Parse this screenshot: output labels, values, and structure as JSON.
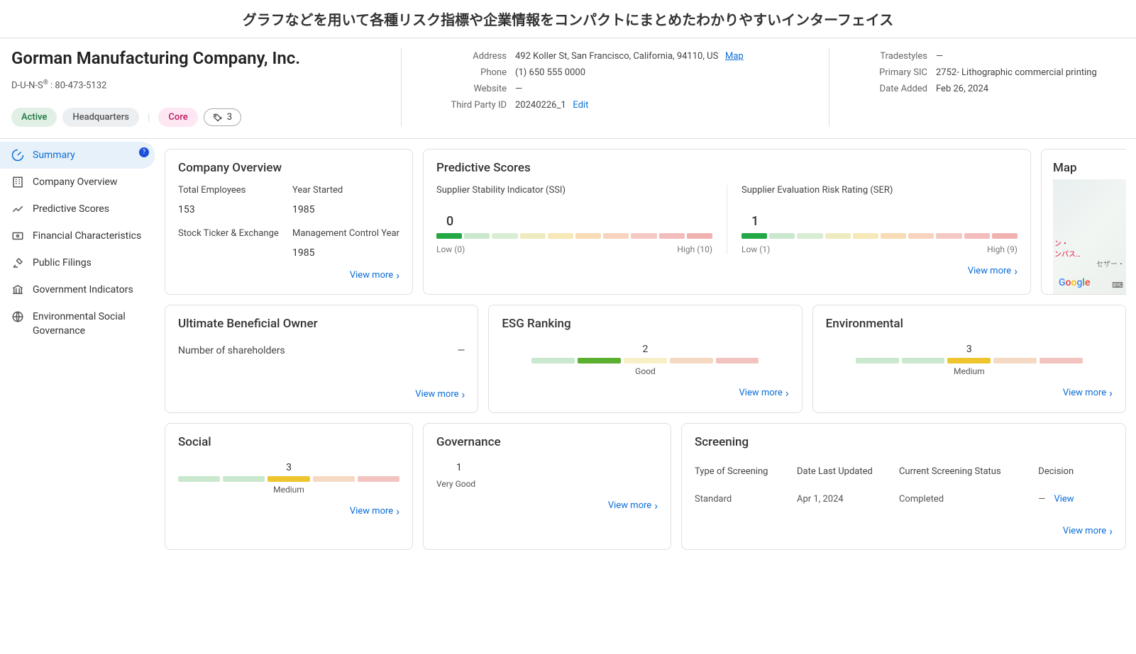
{
  "page_heading": "グラフなどを用いて各種リスク指標や企業情報をコンパクトにまとめたわかりやすいインターフェイス",
  "company": {
    "name": "Gorman Manufacturing Company, Inc.",
    "duns_label": "D-U-N-S",
    "duns_suffix": " : 80-473-5132",
    "badges": {
      "active": "Active",
      "headquarters": "Headquarters",
      "core": "Core",
      "tag_count": "3"
    },
    "contact": {
      "address_label": "Address",
      "address": "492 Koller St, San Francisco, California, 94110, US",
      "map_link": "Map",
      "phone_label": "Phone",
      "phone": "(1) 650 555 0000",
      "website_label": "Website",
      "website": "—",
      "third_party_label": "Third Party ID",
      "third_party": "20240226_1",
      "edit": "Edit"
    },
    "meta": {
      "tradestyles_label": "Tradestyles",
      "tradestyles": "—",
      "primary_sic_label": "Primary SIC",
      "primary_sic": "2752- Lithographic commercial printing",
      "date_added_label": "Date Added",
      "date_added": "Feb 26, 2024"
    }
  },
  "nav": {
    "summary": "Summary",
    "summary_badge": "?",
    "company_overview": "Company Overview",
    "predictive_scores": "Predictive Scores",
    "financial": "Financial Characteristics",
    "public_filings": "Public Filings",
    "government": "Government Indicators",
    "esg": "Environmental Social Governance"
  },
  "overview": {
    "title": "Company Overview",
    "total_employees_label": "Total Employees",
    "total_employees": "153",
    "year_started_label": "Year Started",
    "year_started": "1985",
    "ticker_label": "Stock Ticker & Exchange",
    "mgmt_label": "Management Control Year",
    "mgmt_value": "1985",
    "view_more": "View more"
  },
  "predictive": {
    "title": "Predictive Scores",
    "ssi_title": "Supplier Stability Indicator (SSI)",
    "ssi_score": "0",
    "ssi_low": "Low (0)",
    "ssi_high": "High (10)",
    "ser_title": "Supplier Evaluation Risk Rating (SER)",
    "ser_score": "1",
    "ser_low": "Low (1)",
    "ser_high": "High (9)",
    "view_more": "View more"
  },
  "map": {
    "title": "Map",
    "line1": "ン・",
    "line2": "ンパス…",
    "line3": "セザー・"
  },
  "ubo": {
    "title": "Ultimate Beneficial Owner",
    "shareholders_label": "Number of shareholders",
    "shareholders_value": "—",
    "view_more": "View more"
  },
  "esg_ranking": {
    "title": "ESG Ranking",
    "value": "2",
    "word": "Good",
    "view_more": "View more"
  },
  "environmental": {
    "title": "Environmental",
    "value": "3",
    "word": "Medium",
    "view_more": "View more"
  },
  "social": {
    "title": "Social",
    "value": "3",
    "word": "Medium",
    "view_more": "View more"
  },
  "governance": {
    "title": "Governance",
    "value": "1",
    "word": "Very Good",
    "view_more": "View more"
  },
  "screening": {
    "title": "Screening",
    "h_type": "Type of Screening",
    "h_date": "Date Last Updated",
    "h_status": "Current Screening Status",
    "h_decision": "Decision",
    "r_type": "Standard",
    "r_date": "Apr 1, 2024",
    "r_status": "Completed",
    "r_decision_dash": "—",
    "r_view": "View",
    "view_more": "View more"
  },
  "chart_data": [
    {
      "type": "bar",
      "name": "SSI",
      "title": "Supplier Stability Indicator (SSI)",
      "x_range": [
        0,
        10
      ],
      "value": 0,
      "low_label": "Low (0)",
      "high_label": "High (10)"
    },
    {
      "type": "bar",
      "name": "SER",
      "title": "Supplier Evaluation Risk Rating (SER)",
      "x_range": [
        1,
        9
      ],
      "value": 1,
      "low_label": "Low (1)",
      "high_label": "High (9)"
    },
    {
      "type": "bar",
      "name": "ESG Ranking",
      "scale": [
        1,
        5
      ],
      "value": 2,
      "label": "Good"
    },
    {
      "type": "bar",
      "name": "Environmental",
      "scale": [
        1,
        5
      ],
      "value": 3,
      "label": "Medium"
    },
    {
      "type": "bar",
      "name": "Social",
      "scale": [
        1,
        5
      ],
      "value": 3,
      "label": "Medium"
    },
    {
      "type": "bar",
      "name": "Governance",
      "scale": [
        1,
        5
      ],
      "value": 1,
      "label": "Very Good"
    }
  ]
}
